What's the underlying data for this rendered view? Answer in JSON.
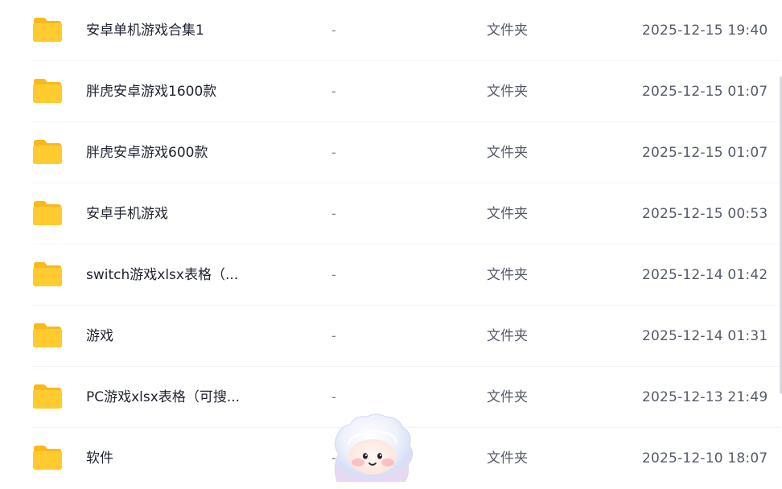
{
  "file_list": {
    "rows": [
      {
        "name": "安卓单机游戏合集1",
        "size": "-",
        "type": "文件夹",
        "modified": "2025-12-15 19:40"
      },
      {
        "name": "胖虎安卓游戏1600款",
        "size": "-",
        "type": "文件夹",
        "modified": "2025-12-15 01:07"
      },
      {
        "name": "胖虎安卓游戏600款",
        "size": "-",
        "type": "文件夹",
        "modified": "2025-12-15 01:07"
      },
      {
        "name": "安卓手机游戏",
        "size": "-",
        "type": "文件夹",
        "modified": "2025-12-15 00:53"
      },
      {
        "name": "switch游戏xlsx表格（...",
        "size": "-",
        "type": "文件夹",
        "modified": "2025-12-14 01:42"
      },
      {
        "name": "游戏",
        "size": "-",
        "type": "文件夹",
        "modified": "2025-12-14 01:31"
      },
      {
        "name": "PC游戏xlsx表格（可搜...",
        "size": "-",
        "type": "文件夹",
        "modified": "2025-12-13 21:49"
      },
      {
        "name": "软件",
        "size": "-",
        "type": "文件夹",
        "modified": "2025-12-10 18:07"
      }
    ]
  },
  "icons": {
    "folder": "folder-icon",
    "assistant": "assistant-mascot-icon"
  },
  "colors": {
    "folder_yellow": "#FFCB2E",
    "folder_back": "#F9B81B",
    "divider": "#F3F3F5"
  }
}
